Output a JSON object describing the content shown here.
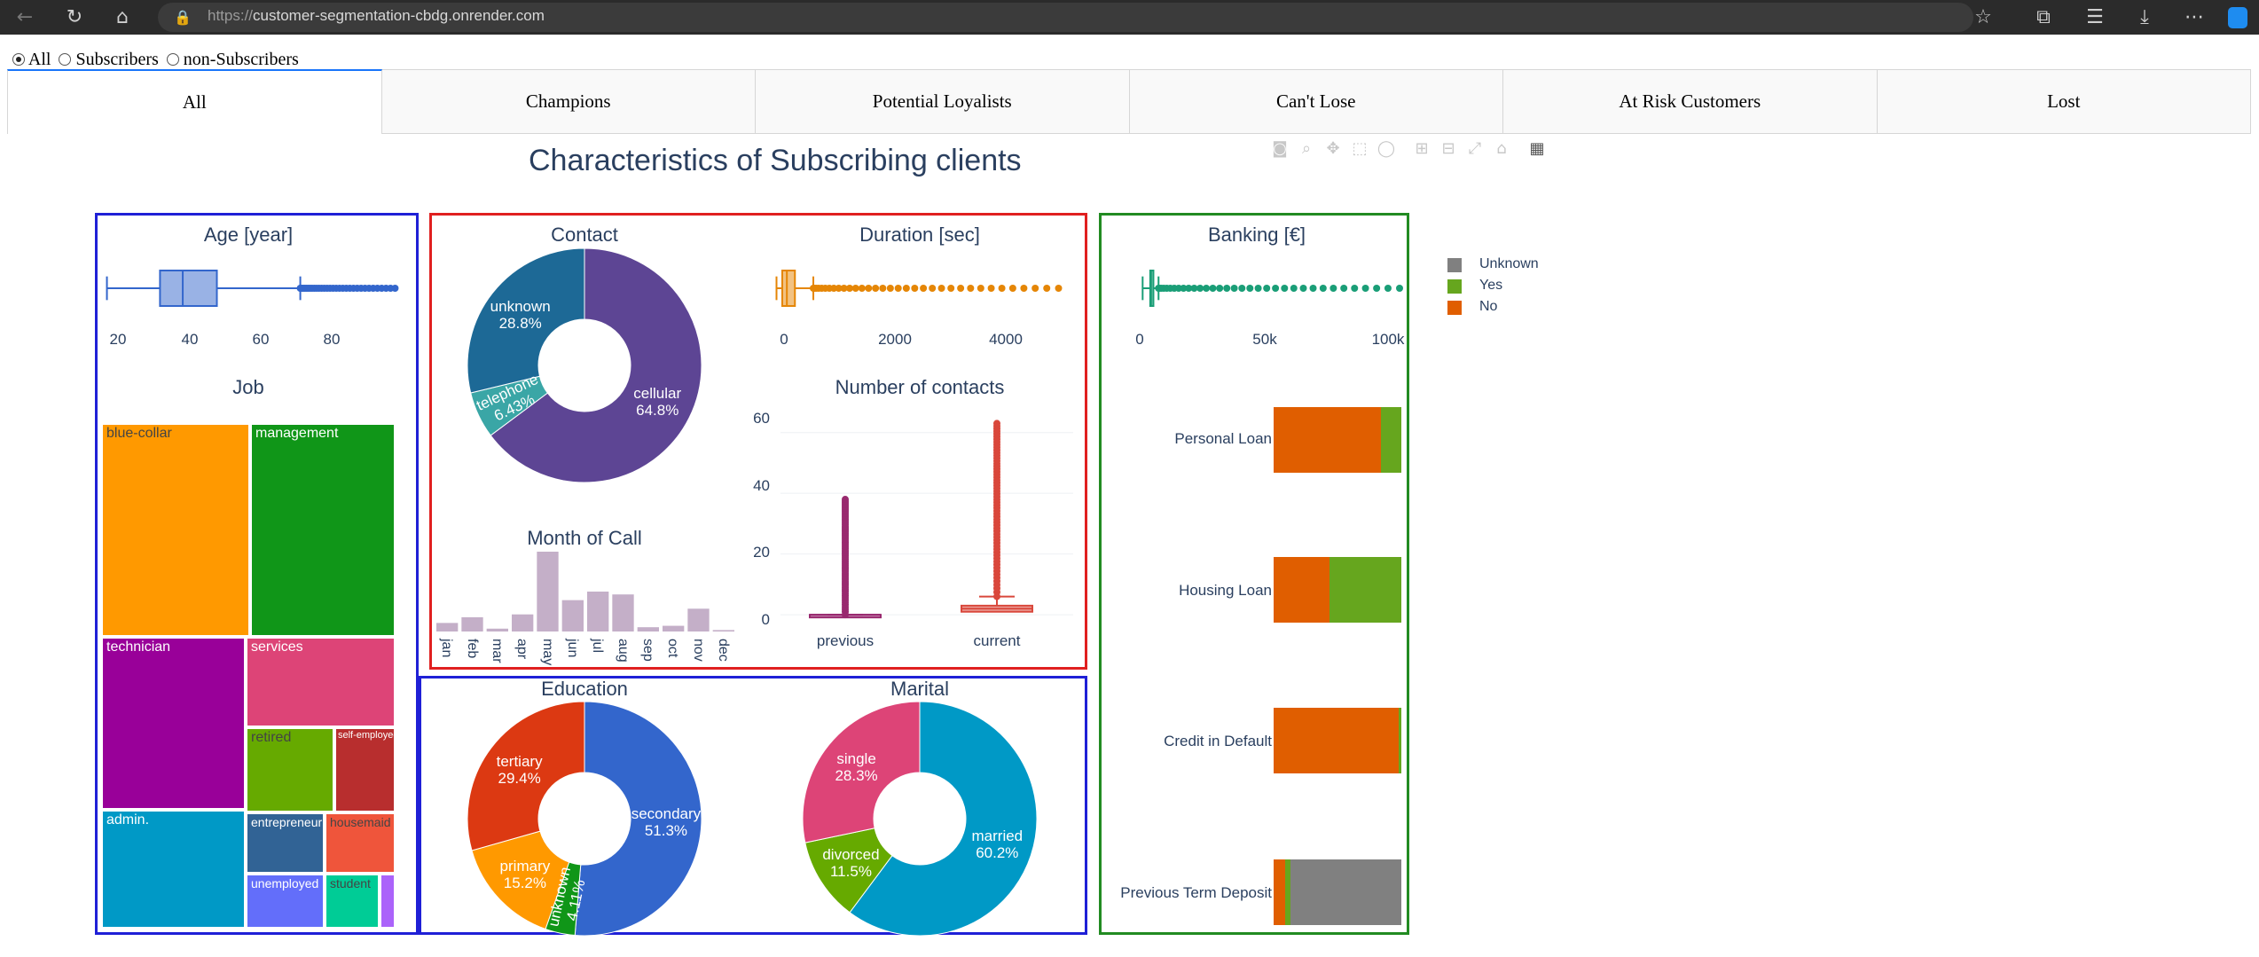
{
  "browser": {
    "url_protocol": "https://",
    "url_host": "customer-segmentation-cbdg.onrender.com",
    "back_icon": "←",
    "reload_icon": "↻",
    "home_icon": "⌂",
    "lock_icon": "🔒",
    "star_icon": "☆",
    "extensions_icon": "⧉",
    "favorites_icon": "☰",
    "download_icon": "⤓",
    "more_icon": "⋯"
  },
  "filter": {
    "options": [
      "All",
      "Subscribers",
      "non-Subscribers"
    ],
    "selected": "All"
  },
  "tabs": [
    "All",
    "Champions",
    "Potential Loyalists",
    "Can't Lose",
    "At Risk Customers",
    "Lost"
  ],
  "active_tab": "All",
  "dashboard_title": "Characteristics of Subscribing clients",
  "colors": {
    "frame_blue": "#1f20d6",
    "frame_red": "#e02020",
    "frame_green": "#228b22",
    "title": "#2a3f5f"
  },
  "chart_data": [
    {
      "id": "age",
      "type": "box",
      "title": "Age [year]",
      "x_ticks": [
        "20",
        "40",
        "60",
        "80"
      ],
      "xlim": [
        17,
        97
      ],
      "box": {
        "min": 19,
        "q1": 33,
        "median": 39,
        "q3": 48,
        "max": 70,
        "outlier_max": 95
      },
      "color": "#3366cc"
    },
    {
      "id": "job",
      "type": "treemap",
      "title": "Job",
      "items": [
        {
          "label": "blue-collar",
          "color": "#ff9900",
          "text_color": "#444444"
        },
        {
          "label": "management",
          "color": "#109618",
          "text_color": "#ffffff"
        },
        {
          "label": "technician",
          "color": "#990099",
          "text_color": "#ffffff"
        },
        {
          "label": "services",
          "color": "#dd4477",
          "text_color": "#ffffff"
        },
        {
          "label": "retired",
          "color": "#66aa00",
          "text_color": "#444444"
        },
        {
          "label": "self-employed",
          "color": "#b82e2e",
          "text_color": "#ffffff"
        },
        {
          "label": "admin.",
          "color": "#0099c6",
          "text_color": "#ffffff"
        },
        {
          "label": "entrepreneur",
          "color": "#316395",
          "text_color": "#ffffff"
        },
        {
          "label": "housemaid",
          "color": "#ef553b",
          "text_color": "#444444"
        },
        {
          "label": "unemployed",
          "color": "#636efa",
          "text_color": "#ffffff"
        },
        {
          "label": "student",
          "color": "#00cc96",
          "text_color": "#444444"
        },
        {
          "label": "",
          "color": "#ab63fa",
          "text_color": "#ffffff"
        }
      ]
    },
    {
      "id": "contact",
      "type": "pie",
      "title": "Contact",
      "slices": [
        {
          "label": "cellular",
          "pct": "64.8%",
          "value": 64.8,
          "color": "#5d4594"
        },
        {
          "label": "telephone",
          "pct": "6.43%",
          "value": 6.43,
          "color": "#3aa6a6"
        },
        {
          "label": "unknown",
          "pct": "28.8%",
          "value": 28.77,
          "color": "#1d6996"
        }
      ]
    },
    {
      "id": "duration",
      "type": "box",
      "title": "Duration [sec]",
      "x_ticks": [
        "0",
        "2000",
        "4000"
      ],
      "xlim": [
        -100,
        5000
      ],
      "box": {
        "min": 0,
        "q1": 100,
        "median": 180,
        "q3": 320,
        "max": 640,
        "outlier_max": 4900
      },
      "color": "#e58606"
    },
    {
      "id": "contacts",
      "type": "box",
      "title": "Number of contacts",
      "categories": [
        "previous",
        "current"
      ],
      "y_ticks": [
        "0",
        "20",
        "40",
        "60"
      ],
      "ylim": [
        -2,
        64
      ],
      "series": [
        {
          "name": "previous",
          "min": 0,
          "q1": 0,
          "median": 0,
          "q3": 0,
          "max": 0,
          "outlier_max": 38,
          "color": "#99296f"
        },
        {
          "name": "current",
          "min": 1,
          "q1": 1,
          "median": 2,
          "q3": 3,
          "max": 6,
          "outlier_max": 63,
          "color": "#d9473b"
        }
      ]
    },
    {
      "id": "month",
      "type": "bar",
      "title": "Month of Call",
      "categories": [
        "jan",
        "feb",
        "mar",
        "apr",
        "may",
        "jun",
        "jul",
        "aug",
        "sep",
        "oct",
        "nov",
        "dec"
      ],
      "values": [
        3,
        5,
        1,
        6,
        28,
        11,
        14,
        13,
        1.5,
        2,
        8,
        0.5
      ],
      "color": "#c4afc8"
    },
    {
      "id": "education",
      "type": "pie",
      "title": "Education",
      "slices": [
        {
          "label": "secondary",
          "pct": "51.3%",
          "value": 51.3,
          "color": "#3366cc"
        },
        {
          "label": "unknown",
          "pct": "4.11%",
          "value": 4.11,
          "color": "#109618"
        },
        {
          "label": "primary",
          "pct": "15.2%",
          "value": 15.2,
          "color": "#ff9900"
        },
        {
          "label": "tertiary",
          "pct": "29.4%",
          "value": 29.39,
          "color": "#dc3912"
        }
      ]
    },
    {
      "id": "marital",
      "type": "pie",
      "title": "Marital",
      "slices": [
        {
          "label": "married",
          "pct": "60.2%",
          "value": 60.2,
          "color": "#0099c6"
        },
        {
          "label": "divorced",
          "pct": "11.5%",
          "value": 11.5,
          "color": "#66aa00"
        },
        {
          "label": "single",
          "pct": "28.3%",
          "value": 28.3,
          "color": "#dd4477"
        }
      ]
    },
    {
      "id": "banking",
      "type": "box",
      "title": "Banking [€]",
      "x_ticks": [
        "0",
        "50k",
        "100k"
      ],
      "xlim": [
        -10000,
        102000
      ],
      "box": {
        "min": -3000,
        "q1": 100,
        "median": 450,
        "q3": 1400,
        "max": 3500,
        "outlier_max": 102000
      },
      "color": "#1a9e77"
    },
    {
      "id": "flags",
      "type": "bar",
      "orientation": "h",
      "categories": [
        "Personal Loan",
        "Housing Loan",
        "Credit in Default",
        "Previous Term Deposit"
      ],
      "legend": [
        "Unknown",
        "Yes",
        "No"
      ],
      "series": [
        {
          "name": "No",
          "color": "#e05e00",
          "values": [
            84,
            44,
            98,
            9
          ]
        },
        {
          "name": "Yes",
          "color": "#66a61e",
          "values": [
            16,
            56,
            2,
            4
          ]
        },
        {
          "name": "Unknown",
          "color": "#808080",
          "values": [
            0,
            0,
            0,
            87
          ]
        }
      ]
    }
  ]
}
